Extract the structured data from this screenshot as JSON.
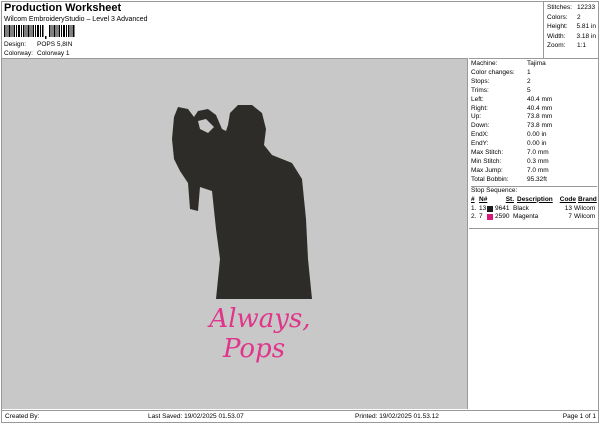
{
  "header": {
    "title": "Production Worksheet",
    "subtitle": "Wilcom EmbroideryStudio – Level 3 Advanced",
    "design_label": "Design:",
    "design_value": "POPS 5,8IN",
    "colorway_label": "Colorway:",
    "colorway_value": "Colorway 1"
  },
  "summary": [
    {
      "k": "Stitches:",
      "v": "12233"
    },
    {
      "k": "Colors:",
      "v": "2"
    },
    {
      "k": "Height:",
      "v": "5.81 in"
    },
    {
      "k": "Width:",
      "v": "3.18 in"
    },
    {
      "k": "Zoom:",
      "v": "1:1"
    }
  ],
  "details": [
    {
      "k": "Machine:",
      "v": "Tajima"
    },
    {
      "k": "Color changes:",
      "v": "1"
    },
    {
      "k": "Stops:",
      "v": "2"
    },
    {
      "k": "Trims:",
      "v": "5"
    },
    {
      "k": "Left:",
      "v": "40.4 mm"
    },
    {
      "k": "Right:",
      "v": "40.4 mm"
    },
    {
      "k": "Up:",
      "v": "73.8 mm"
    },
    {
      "k": "Down:",
      "v": "73.8 mm"
    },
    {
      "k": "EndX:",
      "v": "0.00 in"
    },
    {
      "k": "EndY:",
      "v": "0.00 in"
    },
    {
      "k": "Max Stitch:",
      "v": "7.0 mm"
    },
    {
      "k": "Min Stitch:",
      "v": "0.3 mm"
    },
    {
      "k": "Max Jump:",
      "v": "7.0 mm"
    },
    {
      "k": "Total Bobbin:",
      "v": "95.32ft"
    }
  ],
  "stop_sequence": {
    "title": "Stop Sequence:",
    "headers": [
      "#",
      "N#",
      "St.",
      "Description",
      "Code",
      "Brand"
    ],
    "rows": [
      {
        "num": "1.",
        "n": "13",
        "st": "9641",
        "desc": "Black",
        "code": "13",
        "brand": "Wilcom",
        "color": "#1a1a1a"
      },
      {
        "num": "2.",
        "n": "7",
        "st": "2590",
        "desc": "Magenta",
        "code": "7",
        "brand": "Wilcom",
        "color": "#d81b7a"
      }
    ]
  },
  "design_text": {
    "line1": "Always,",
    "line2": "Pops"
  },
  "colors": {
    "thread1": "#2e2c28",
    "thread2": "#e0358a",
    "canvas": "#c8c8c8"
  },
  "footer": {
    "created": "Created By:",
    "saved": "Last Saved: 19/02/2025 01.53.07",
    "printed": "Printed: 19/02/2025 01.53.12",
    "page": "Page 1 of 1"
  }
}
